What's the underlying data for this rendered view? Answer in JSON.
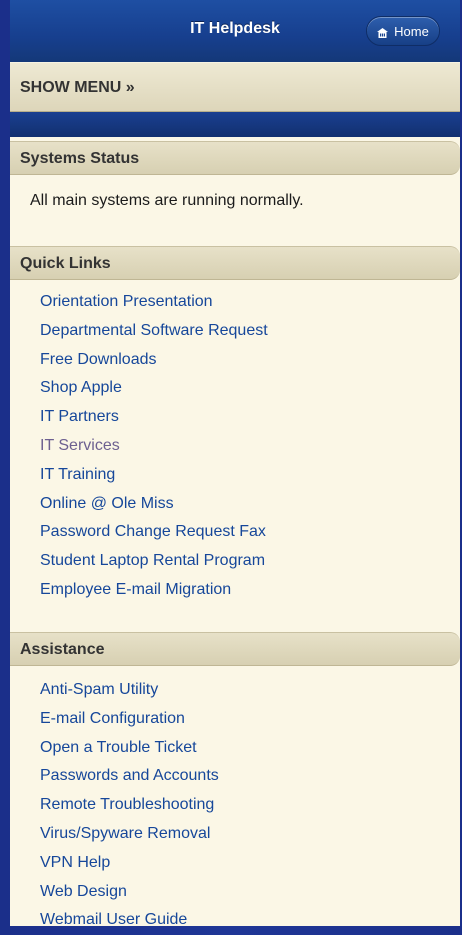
{
  "header": {
    "title": "IT Helpdesk",
    "home_label": "Home"
  },
  "menu": {
    "label": "SHOW MENU »"
  },
  "systems_status": {
    "heading": "Systems Status",
    "text": "All main systems are running normally."
  },
  "quick_links": {
    "heading": "Quick Links",
    "items": [
      "Orientation Presentation",
      "Departmental Software Request",
      "Free Downloads",
      "Shop Apple",
      "IT Partners",
      "IT Services",
      "IT Training",
      "Online @ Ole Miss",
      "Password Change Request Fax",
      "Student Laptop Rental Program",
      "Employee E-mail Migration"
    ]
  },
  "assistance": {
    "heading": "Assistance",
    "items": [
      "Anti-Spam Utility",
      "E-mail Configuration",
      "Open a Trouble Ticket",
      "Passwords and Accounts",
      "Remote Troubleshooting",
      "Virus/Spyware Removal",
      "VPN Help",
      "Web Design",
      "Webmail User Guide"
    ]
  },
  "colors": {
    "link": "#16479a",
    "visited_link": "#6d6090",
    "header_blue": "#173f8e",
    "background_blue": "#1f3696"
  }
}
